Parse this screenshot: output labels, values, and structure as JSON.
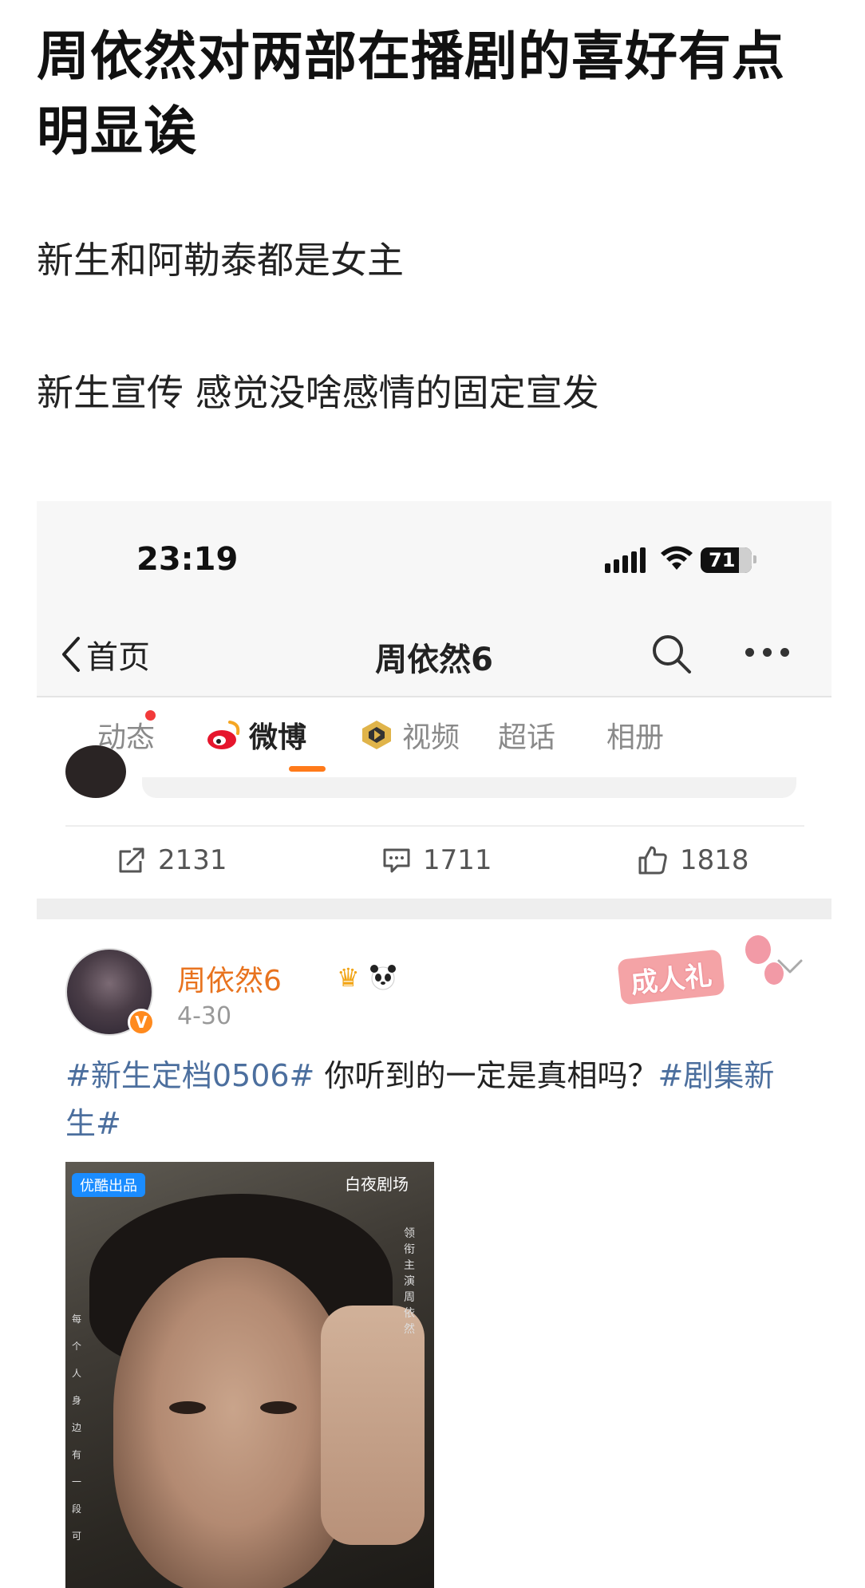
{
  "post": {
    "title": "周依然对两部在播剧的喜好有点明显诶",
    "para1": "新生和阿勒泰都是女主",
    "para2": "新生宣传 感觉没啥感情的固定宣发"
  },
  "screenshot": {
    "status": {
      "time": "23:19",
      "battery": "71"
    },
    "nav": {
      "back_label": "首页",
      "title": "周依然6"
    },
    "tabs": [
      {
        "label": "动态"
      },
      {
        "label": "微博"
      },
      {
        "label": "视频"
      },
      {
        "label": "超话"
      },
      {
        "label": "相册"
      }
    ],
    "actions": {
      "repost": "2131",
      "comment": "1711",
      "like": "1818"
    },
    "weibo": {
      "author": "周依然6",
      "verified_mark": "V",
      "date": "4-30",
      "badge": "成人礼",
      "body_tag1": "#新生定档0506#",
      "body_text": " 你听到的一定是真相吗？",
      "body_tag2": "#剧集新生#",
      "poster": {
        "tag": "优酷出品",
        "brand": "白夜剧场",
        "credit": "领衔主演 周依然",
        "vertical": "每个人身边有一段可"
      }
    },
    "colors": {
      "accent": "#ff7a1a",
      "hashtag": "#4c6f9e",
      "name": "#e8731f"
    }
  }
}
